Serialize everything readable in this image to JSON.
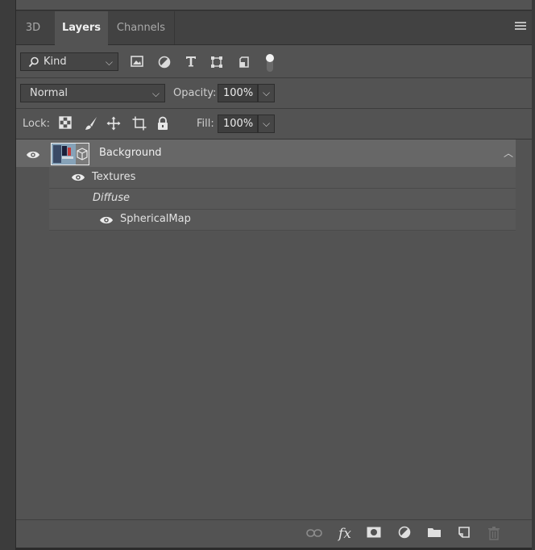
{
  "tabs": [
    {
      "label": "3D",
      "active": false
    },
    {
      "label": "Layers",
      "active": true
    },
    {
      "label": "Channels",
      "active": false
    }
  ],
  "filter": {
    "kind_label": "Kind",
    "icons": [
      "pixel-layer-filter-icon",
      "adjustment-layer-filter-icon",
      "type-layer-filter-icon",
      "shape-layer-filter-icon",
      "smart-object-filter-icon",
      "filter-toggle-icon"
    ]
  },
  "blend": {
    "mode": "Normal",
    "opacity_label": "Opacity:",
    "opacity_value": "100%"
  },
  "lock": {
    "label": "Lock:",
    "icons": [
      "lock-transparent-pixels-icon",
      "lock-image-pixels-icon",
      "lock-position-icon",
      "lock-artboard-icon",
      "lock-all-icon"
    ],
    "fill_label": "Fill:",
    "fill_value": "100%"
  },
  "layers": {
    "background": {
      "name": "Background",
      "visible": true
    },
    "textures_label": "Textures",
    "diffuse_label": "Diffuse",
    "spherical_label": "SphericalMap"
  },
  "bottom_icons": [
    "link-layers-icon",
    "fx-icon",
    "add-mask-icon",
    "adjustment-layer-icon",
    "new-group-icon",
    "new-layer-icon",
    "trash-icon"
  ],
  "fx_text": "fx",
  "colors": {
    "panel_bg": "#535353",
    "selected_row": "#676767",
    "tab_bar": "#424242"
  }
}
